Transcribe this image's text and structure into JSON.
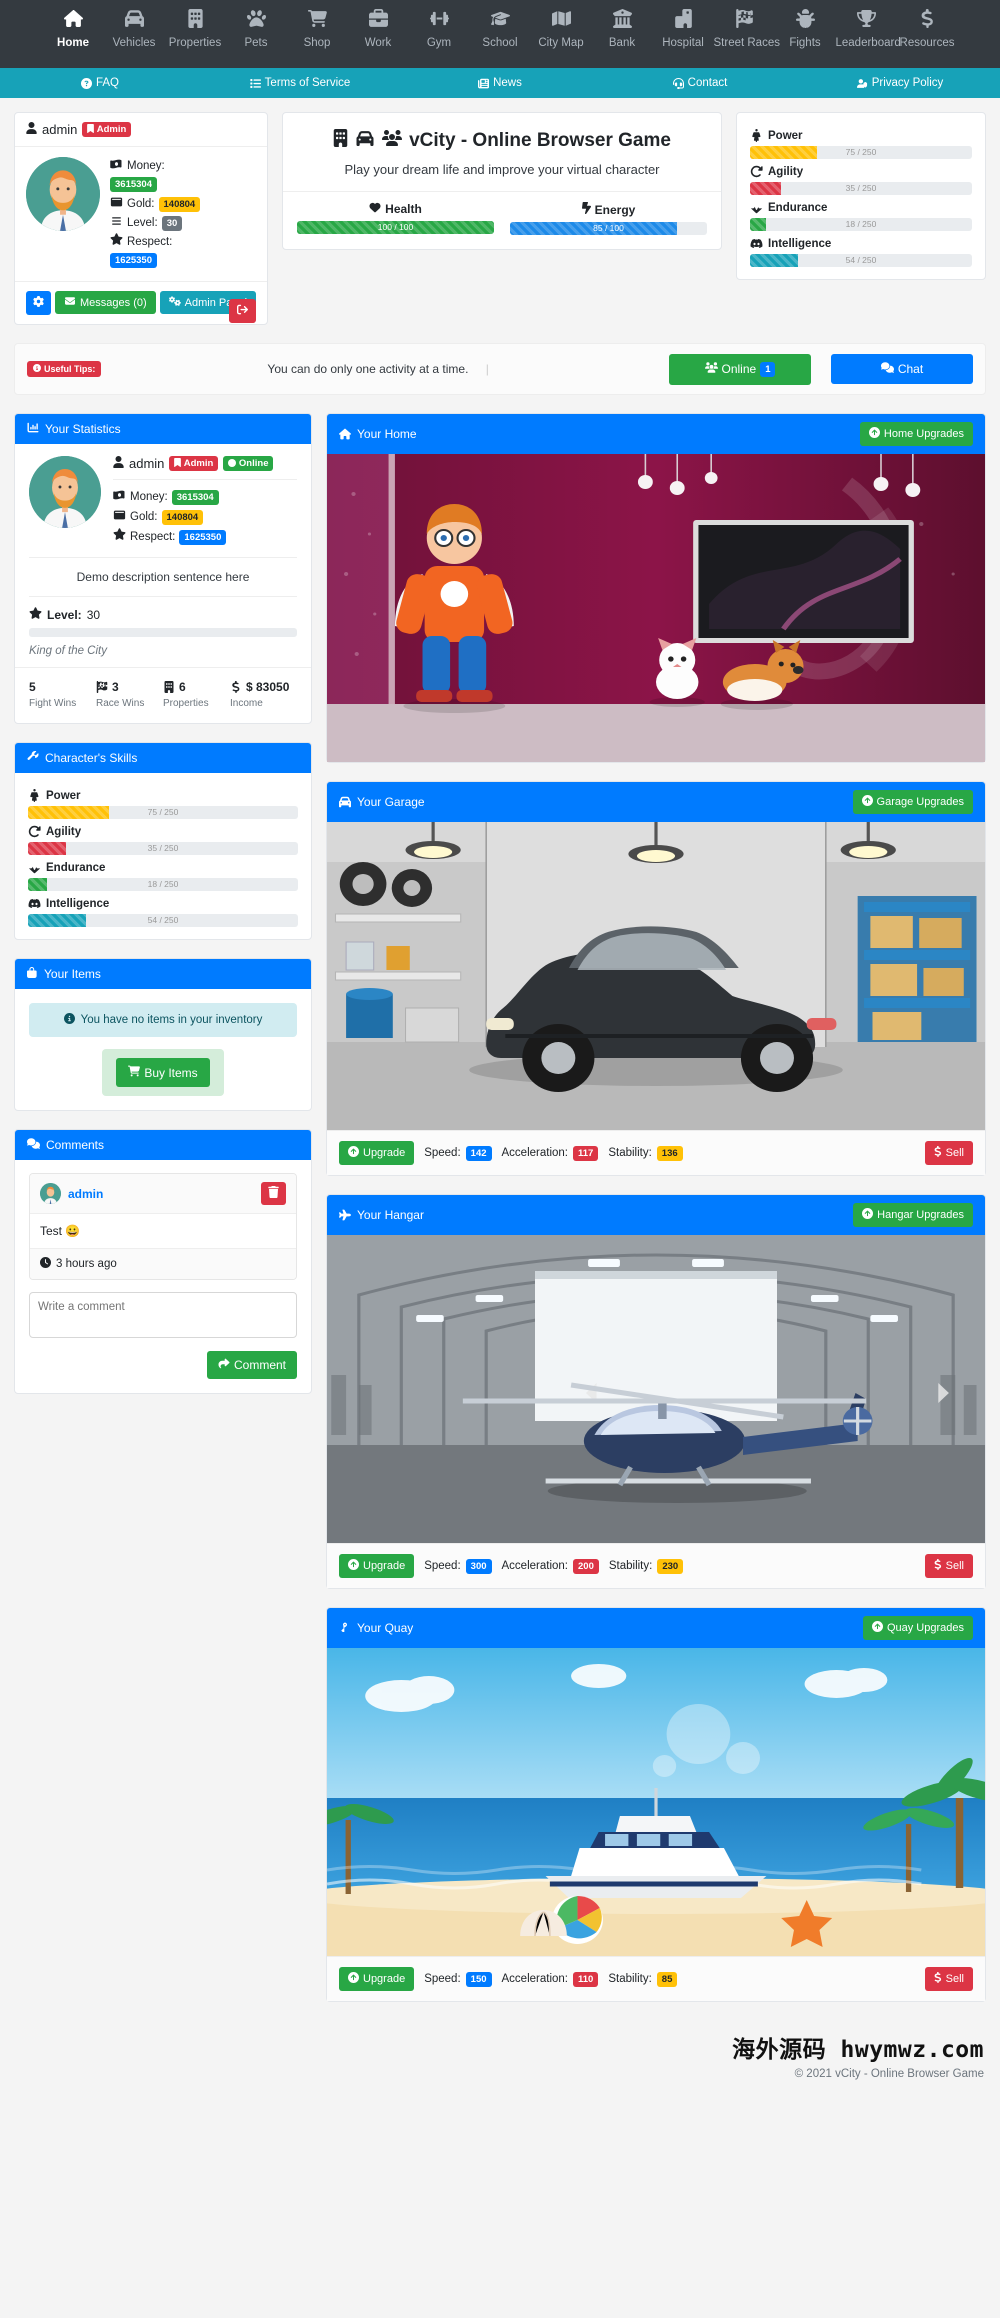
{
  "nav": {
    "items": [
      {
        "label": "Home",
        "icon": "home-icon",
        "active": true
      },
      {
        "label": "Vehicles",
        "icon": "car-icon",
        "active": false
      },
      {
        "label": "Properties",
        "icon": "building-icon",
        "active": false
      },
      {
        "label": "Pets",
        "icon": "paw-icon",
        "active": false
      },
      {
        "label": "Shop",
        "icon": "cart-icon",
        "active": false
      },
      {
        "label": "Work",
        "icon": "briefcase-icon",
        "active": false
      },
      {
        "label": "Gym",
        "icon": "dumbbell-icon",
        "active": false
      },
      {
        "label": "School",
        "icon": "graduation-cap-icon",
        "active": false
      },
      {
        "label": "City Map",
        "icon": "map-icon",
        "active": false
      },
      {
        "label": "Bank",
        "icon": "bank-icon",
        "active": false
      },
      {
        "label": "Hospital",
        "icon": "hospital-icon",
        "active": false
      },
      {
        "label": "Street Races",
        "icon": "checkered-flag-icon",
        "active": false
      },
      {
        "label": "Fights",
        "icon": "fist-icon",
        "active": false
      },
      {
        "label": "Leaderboard",
        "icon": "trophy-icon",
        "active": false
      },
      {
        "label": "Resources",
        "icon": "dollar-icon",
        "active": false
      }
    ]
  },
  "subnav": {
    "items": [
      {
        "label": "FAQ",
        "icon": "question-circle-icon"
      },
      {
        "label": "Terms of Service",
        "icon": "list-icon"
      },
      {
        "label": "News",
        "icon": "newspaper-icon"
      },
      {
        "label": "Contact",
        "icon": "headset-icon"
      },
      {
        "label": "Privacy Policy",
        "icon": "user-shield-icon"
      }
    ]
  },
  "userbox": {
    "username": "admin",
    "role_badge": "Admin",
    "money_label": "Money:",
    "money_value": "3615304",
    "gold_label": "Gold:",
    "gold_value": "140804",
    "level_label": "Level:",
    "level_value": "30",
    "respect_label": "Respect:",
    "respect_value": "1625350",
    "settings_icon": "gear-icon",
    "messages_label": "Messages (0)",
    "admin_panel_label": "Admin Panel",
    "logout_icon": "sign-out-icon"
  },
  "hero": {
    "title": "vCity - Online Browser Game",
    "subtitle": "Play your dream life and improve your virtual character",
    "health": {
      "label": "Health",
      "value": 100,
      "max": 100,
      "text": "100 / 100",
      "color": "#28a745"
    },
    "energy": {
      "label": "Energy",
      "value": 85,
      "max": 100,
      "text": "85 / 100",
      "color": "#1d8ae8"
    }
  },
  "skills": [
    {
      "label": "Power",
      "icon": "power-icon",
      "value": 75,
      "max": 250,
      "text": "75 / 250",
      "color": "#ffc107"
    },
    {
      "label": "Agility",
      "icon": "agility-icon",
      "value": 35,
      "max": 250,
      "text": "35 / 250",
      "color": "#dc3545"
    },
    {
      "label": "Endurance",
      "icon": "heartbeat-icon",
      "value": 18,
      "max": 250,
      "text": "18 / 250",
      "color": "#28a745"
    },
    {
      "label": "Intelligence",
      "icon": "brain-icon",
      "value": 54,
      "max": 250,
      "text": "54 / 250",
      "color": "#17a2b8"
    }
  ],
  "tipsbar": {
    "badge": "Useful Tips:",
    "message": "You can do only one activity at a time.",
    "separator": "|",
    "online_label": "Online",
    "online_count": "1",
    "chat_label": "Chat"
  },
  "statistics": {
    "card_title": "Your Statistics",
    "username": "admin",
    "role_badge": "Admin",
    "status_badge": "Online",
    "money_label": "Money:",
    "money_value": "3615304",
    "gold_label": "Gold:",
    "gold_value": "140804",
    "respect_label": "Respect:",
    "respect_value": "1625350",
    "description": "Demo description sentence here",
    "level_label": "Level:",
    "level_value": "30",
    "rank_title": "King of the City",
    "quick": [
      {
        "value": "5",
        "label": "Fight Wins",
        "icon": "bolt-icon"
      },
      {
        "value": "3",
        "label": "Race Wins",
        "icon": "checkered-flag-icon"
      },
      {
        "value": "6",
        "label": "Properties",
        "icon": "building-icon"
      },
      {
        "value": "$ 83050",
        "label": "Income",
        "icon": "dollar-icon"
      }
    ]
  },
  "skills_card": {
    "title": "Character's Skills"
  },
  "items_card": {
    "title": "Your Items",
    "empty_message": "You have no items in your inventory",
    "buy_label": "Buy Items"
  },
  "comments_card": {
    "title": "Comments",
    "comment": {
      "author": "admin",
      "text": "Test 😀",
      "time": "3 hours ago",
      "delete_icon": "trash-icon"
    },
    "input_placeholder": "Write a comment",
    "submit_label": "Comment"
  },
  "assets": [
    {
      "title": "Your Home",
      "icon": "home-icon",
      "upgrade_button": "Home Upgrades",
      "scene": "home",
      "has_specs": false
    },
    {
      "title": "Your Garage",
      "icon": "car-icon",
      "upgrade_button": "Garage Upgrades",
      "scene": "garage",
      "has_specs": true,
      "upgrade_label": "Upgrade",
      "sell_label": "Sell",
      "specs": [
        {
          "label": "Speed:",
          "value": "142",
          "color": "blue"
        },
        {
          "label": "Acceleration:",
          "value": "117",
          "color": "red"
        },
        {
          "label": "Stability:",
          "value": "136",
          "color": "yellow"
        }
      ]
    },
    {
      "title": "Your Hangar",
      "icon": "plane-icon",
      "upgrade_button": "Hangar Upgrades",
      "scene": "hangar",
      "has_specs": true,
      "upgrade_label": "Upgrade",
      "sell_label": "Sell",
      "specs": [
        {
          "label": "Speed:",
          "value": "300",
          "color": "blue"
        },
        {
          "label": "Acceleration:",
          "value": "200",
          "color": "red"
        },
        {
          "label": "Stability:",
          "value": "230",
          "color": "yellow"
        }
      ]
    },
    {
      "title": "Your Quay",
      "icon": "anchor-icon",
      "upgrade_button": "Quay Upgrades",
      "scene": "quay",
      "has_specs": true,
      "upgrade_label": "Upgrade",
      "sell_label": "Sell",
      "specs": [
        {
          "label": "Speed:",
          "value": "150",
          "color": "blue"
        },
        {
          "label": "Acceleration:",
          "value": "110",
          "color": "red"
        },
        {
          "label": "Stability:",
          "value": "85",
          "color": "yellow"
        }
      ]
    }
  ],
  "footer": {
    "watermark": "海外源码 hwymwz.com",
    "copyright": "© 2021 vCity - Online Browser Game"
  },
  "colors": {
    "nav_bg": "#343a40",
    "subnav_bg": "#17a2b8",
    "primary": "#007bff",
    "success": "#28a745",
    "danger": "#dc3545",
    "warning": "#ffc107",
    "info": "#17a2b8"
  }
}
